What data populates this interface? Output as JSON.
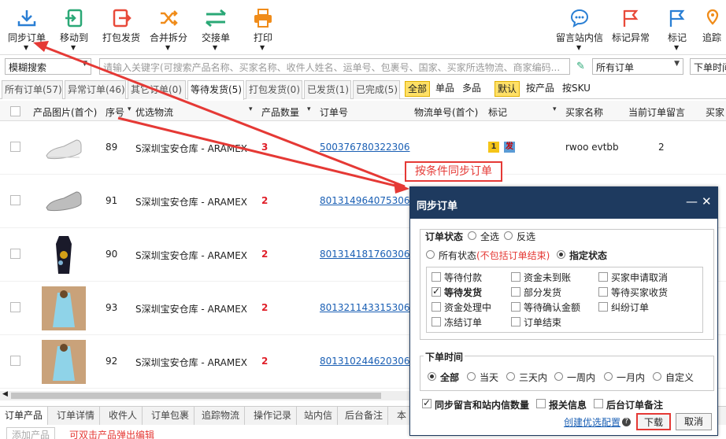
{
  "toolbar": {
    "sync_orders": "同步订单",
    "move_to": "移动到",
    "pack_ship": "打包发货",
    "merge_split": "合并拆分",
    "handover": "交接单",
    "print": "打印",
    "message": "留言站内信",
    "mark_exception": "标记异常",
    "mark": "标记",
    "track": "追踪"
  },
  "filter": {
    "search_type": "模糊搜索",
    "search_placeholder": "请输入关键字(可搜索产品名称、买家名称、收件人姓名、运单号、包裹号、国家、买家所选物流、商家编码...",
    "order_scope": "所有订单",
    "sort_by": "下单时间"
  },
  "status_tabs": [
    "所有订单(57)",
    "异常订单(46)",
    "其它订单(0)",
    "等待发货(5)",
    "打包发货(0)",
    "已发货(1)",
    "已完成(5)"
  ],
  "view_options": [
    "全部",
    "单品",
    "多品",
    "默认",
    "按产品",
    "按SKU"
  ],
  "columns": {
    "image": "产品图片(首个)",
    "seq": "序号",
    "logistics": "优选物流",
    "qty": "产品数量",
    "order_no": "订单号",
    "tracking": "物流单号(首个)",
    "mark": "标记",
    "buyer": "买家名称",
    "message": "当前订单留言",
    "buyer2": "买家"
  },
  "rows": [
    {
      "seq": "89",
      "logistics": "S深圳宝安仓库 - ARAMEX",
      "qty": "3",
      "order_no": "500376780322306",
      "buyer": "rwoo evtbb",
      "message": "2",
      "mark_a": "1",
      "mark_b": "发"
    },
    {
      "seq": "91",
      "logistics": "S深圳宝安仓库 - ARAMEX",
      "qty": "2",
      "order_no": "801314964075306"
    },
    {
      "seq": "90",
      "logistics": "S深圳宝安仓库 - ARAMEX",
      "qty": "2",
      "order_no": "801314181760306"
    },
    {
      "seq": "93",
      "logistics": "S深圳宝安仓库 - ARAMEX",
      "qty": "2",
      "order_no": "801321143315306"
    },
    {
      "seq": "92",
      "logistics": "S深圳宝安仓库 - ARAMEX",
      "qty": "2",
      "order_no": "801310244620306"
    }
  ],
  "callout": "按条件同步订单",
  "dialog": {
    "title": "同步订单",
    "status_group": "订单状态",
    "select_all": "全选",
    "invert": "反选",
    "all_status": "所有状态",
    "all_status_note": "(不包括订单结束)",
    "specified_status": "指定状态",
    "statuses": [
      {
        "label": "等待付款",
        "checked": false
      },
      {
        "label": "资金未到账",
        "checked": false
      },
      {
        "label": "买家申请取消",
        "checked": false
      },
      {
        "label": "等待发货",
        "checked": true
      },
      {
        "label": "部分发货",
        "checked": false
      },
      {
        "label": "等待买家收货",
        "checked": false
      },
      {
        "label": "资金处理中",
        "checked": false
      },
      {
        "label": "等待确认金额",
        "checked": false
      },
      {
        "label": "纠纷订单",
        "checked": false
      },
      {
        "label": "冻结订单",
        "checked": false
      },
      {
        "label": "订单结束",
        "checked": false
      }
    ],
    "time_group": "下单时间",
    "time_options": [
      "全部",
      "当天",
      "三天内",
      "一周内",
      "一月内",
      "自定义"
    ],
    "sync_messages": "同步留言和站内信数量",
    "customs_info": "报关信息",
    "backend_note": "后台订单备注",
    "create_config": "创建优选配置",
    "download": "下载",
    "cancel": "取消"
  },
  "bottom_tabs": [
    "订单产品",
    "订单详情",
    "收件人",
    "订单包裹",
    "追踪物流",
    "操作记录",
    "站内信",
    "后台备注",
    "本"
  ],
  "subbar": {
    "add_product": "添加产品",
    "hint": "可双击产品弹出编辑"
  },
  "colors": {
    "dialog_header": "#1e3a5f",
    "annotation": "#e53935",
    "link": "#1a5fb4"
  }
}
